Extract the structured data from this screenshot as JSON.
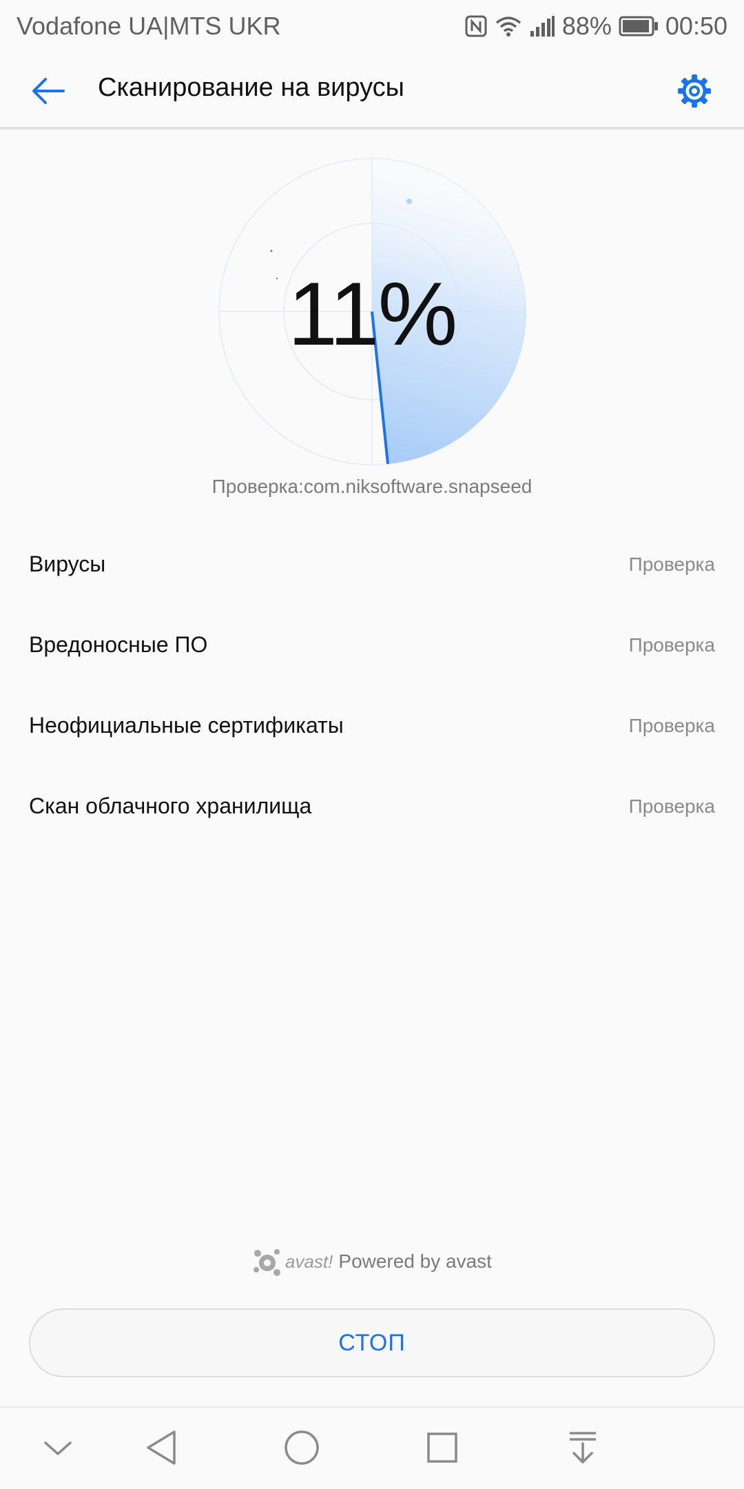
{
  "status_bar": {
    "carrier": "Vodafone UA|MTS UKR",
    "battery": "88%",
    "time": "00:50",
    "icons": [
      "nfc-icon",
      "wifi-icon",
      "signal-icon",
      "battery-icon"
    ]
  },
  "app_bar": {
    "title": "Сканирование на вирусы",
    "back_icon": "arrow-left-icon",
    "settings_icon": "gear-icon",
    "accent_color": "#1a73e8"
  },
  "scan": {
    "progress_percent": 11,
    "progress_label": "11%",
    "status_text": "Проверка:com.niksoftware.snapseed"
  },
  "checks": [
    {
      "label": "Вирусы",
      "status": "Проверка"
    },
    {
      "label": "Вредоносные ПО",
      "status": "Проверка"
    },
    {
      "label": "Неофициальные сертификаты",
      "status": "Проверка"
    },
    {
      "label": "Скан облачного хранилища",
      "status": "Проверка"
    }
  ],
  "footer": {
    "brand_logo_text": "avast!",
    "powered_text": "Powered by avast"
  },
  "actions": {
    "stop_label": "СТОП"
  },
  "nav_bar": {
    "icons": [
      "chevron-down-icon",
      "back-triangle-icon",
      "home-circle-icon",
      "recents-square-icon",
      "notification-pull-icon"
    ]
  }
}
